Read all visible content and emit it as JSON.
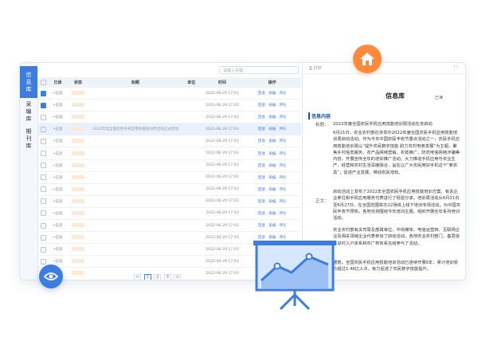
{
  "sidebar": {
    "items": [
      {
        "label": "信息库"
      },
      {
        "label": "采编库"
      },
      {
        "label": "期刊库"
      }
    ]
  },
  "search": {
    "placeholder": "请输入关键"
  },
  "table": {
    "headers": [
      "",
      "已读",
      "状态",
      "标题",
      "单位",
      "时间",
      "操作"
    ],
    "rows": [
      {
        "read": "已读",
        "title": "",
        "unit": "",
        "time": "2022-06-29 17:03"
      },
      {
        "read": "已读",
        "title": "",
        "unit": "",
        "time": "2022-06-29 17:03"
      },
      {
        "read": "已读",
        "title": "",
        "unit": "",
        "time": "2022-06-29 17:03"
      },
      {
        "read": "已读",
        "title": "2022年度全国农民手机应用技能培训周活动正式启动",
        "unit": "",
        "time": "2022-06-29 17:03"
      },
      {
        "read": "已读",
        "title": "",
        "unit": "",
        "time": "2022-06-29 17:03"
      },
      {
        "read": "已读",
        "title": "",
        "unit": "",
        "time": "2022-06-29 17:03"
      },
      {
        "read": "已读",
        "title": "",
        "unit": "",
        "time": "2022-06-29 17:03"
      },
      {
        "read": "已读",
        "title": "",
        "unit": "",
        "time": "2022-06-29 17:03"
      },
      {
        "read": "已读",
        "title": "",
        "unit": "",
        "time": "2022-06-29 17:03"
      },
      {
        "read": "已读",
        "title": "",
        "unit": "",
        "time": "2022-06-29 17:03"
      },
      {
        "read": "已读",
        "title": "",
        "unit": "",
        "time": "2022-06-29 17:03"
      },
      {
        "read": "已读",
        "title": "",
        "unit": "",
        "time": "2022-06-29 17:03"
      },
      {
        "read": "已读",
        "title": "",
        "unit": "",
        "time": "2022-06-29 17:03"
      },
      {
        "read": "已读",
        "title": "",
        "unit": "",
        "time": "2022-06-29 17:03"
      },
      {
        "read": "已读",
        "title": "",
        "unit": "",
        "time": "2022-06-29 17:03"
      },
      {
        "read": "已读",
        "title": "",
        "unit": "",
        "time": "2022-06-29 17:03"
      },
      {
        "read": "已读",
        "title": "",
        "unit": "",
        "time": "2022-06-29 17:03"
      },
      {
        "read": "已读",
        "title": "",
        "unit": "",
        "time": "2022-06-29 17:03"
      },
      {
        "read": "已读",
        "title": "",
        "unit": "",
        "time": "2022-06-29 17:03"
      }
    ],
    "ops": [
      "回退",
      "采编",
      "评论"
    ]
  },
  "pager": {
    "pages": [
      "<",
      "1",
      "2",
      "3",
      ">"
    ]
  },
  "detail": {
    "print_label": "打印",
    "title": "信息库",
    "status": "已读",
    "section": "信息内容",
    "label_title": "标题：",
    "label_body": "正文：",
    "headline": "2022年度全国农民手机应用技能培训周活动在京启动",
    "p1": "6月21日，农业农村部在京举办2022年度全国农民手机应用技能培训周启动活动。作为今年中国农民丰收节重点活动之一，农民手机应用技能培训周以“提升农民数字技能 助力农村电商发展”为主题，聚焦乡村信息服务、农产品网络营销、农技推广、防范电信网络诈骗等内容，开展宣传全年的培训推广活动。大力推进手机应用与农业生产、经营和农村生活深度融合，旨在让广大农民用好手机这个“新农具”，促进产业发展，带动农民增收。",
    "p2": "启动活动上发布了2022年全国农民手机应用技能培训方案，有关企业单位和手机应用服务代表进行了经验分享。培训周活动从6月21日至6月27日，在全国范围举办22场线上线下培训专场活动，为中国农民丰收节预热。各地也将围绕今年培训主题，组织开展全年系列培训活动。",
    "p3": "农业农村部有关司局及部属单位、中央媒体、电信运营商、互联网企业及相关领域企业代表参加了启动活动。各地农业农村部门、基层信息进村入户体系和农广校体系在线参与了活动。",
    "p4": "据悉，全国农民手机应用技能培训活动已连续开展6年，累计培训受众超过1.46亿人次，有力促进了农民数字技能提升。"
  },
  "colors": {
    "accent": "#3d7de0",
    "orange": "#ff8a3d"
  }
}
